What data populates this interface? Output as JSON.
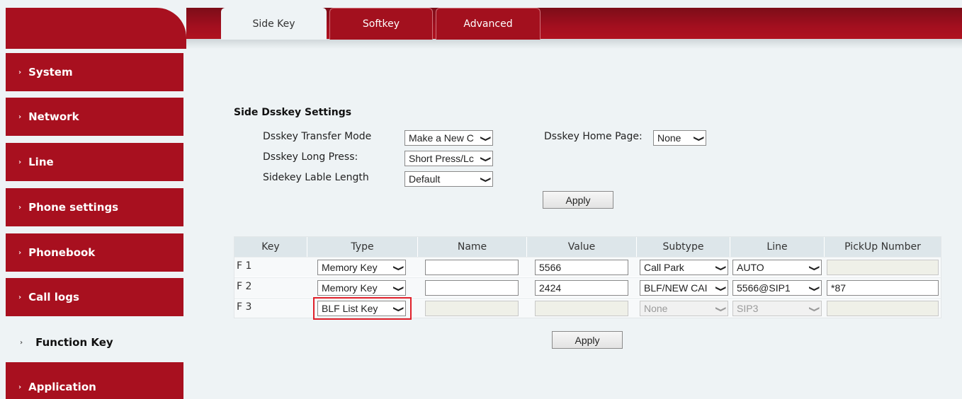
{
  "sidebar": {
    "items": [
      {
        "label": "System"
      },
      {
        "label": "Network"
      },
      {
        "label": "Line"
      },
      {
        "label": "Phone settings"
      },
      {
        "label": "Phonebook"
      },
      {
        "label": "Call logs"
      },
      {
        "label": "Function Key"
      },
      {
        "label": "Application"
      }
    ],
    "active_index": 6,
    "arrow": "›"
  },
  "tabs": [
    {
      "label": "Side Key",
      "active": true
    },
    {
      "label": "Softkey",
      "active": false
    },
    {
      "label": "Advanced",
      "active": false
    }
  ],
  "settings": {
    "title": "Side Dsskey Settings",
    "transfer_mode_label": "Dsskey Transfer Mode",
    "transfer_mode_value": "Make a New C",
    "long_press_label": "Dsskey Long Press:",
    "long_press_value": "Short Press/Lc",
    "label_length_label": "Sidekey Lable Length",
    "label_length_value": "Default",
    "home_page_label": "Dsskey Home Page:",
    "home_page_value": "None",
    "apply_label": "Apply"
  },
  "table": {
    "headers": [
      "Key",
      "Type",
      "Name",
      "Value",
      "Subtype",
      "Line",
      "PickUp Number"
    ],
    "rows": [
      {
        "key": "F 1",
        "type": "Memory Key",
        "name": "",
        "value": "5566",
        "subtype": "Call Park",
        "line": "AUTO",
        "pickup": ""
      },
      {
        "key": "F 2",
        "type": "Memory Key",
        "name": "",
        "value": "2424",
        "subtype": "BLF/NEW CAI",
        "line": "5566@SIP1",
        "pickup": "*87"
      },
      {
        "key": "F 3",
        "type": "BLF List Key",
        "name": "",
        "value": "",
        "subtype": "None",
        "line": "SIP3",
        "pickup": ""
      }
    ],
    "apply_label": "Apply"
  },
  "colors": {
    "brand_red": "#a8101f",
    "background": "#eef3f5",
    "highlight": "#e0202a"
  },
  "icons": {
    "chevron": "chevron-down-icon",
    "nav_arrow": "nav-arrow-icon"
  }
}
